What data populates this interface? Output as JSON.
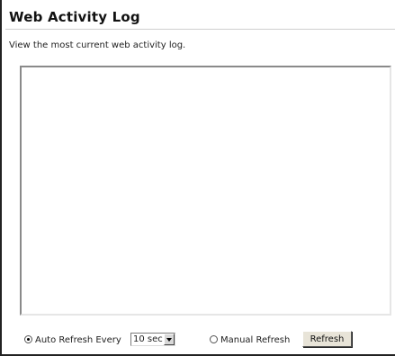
{
  "page": {
    "title": "Web Activity Log",
    "description": "View the most current web activity log."
  },
  "log": {
    "content": ""
  },
  "controls": {
    "auto_refresh": {
      "label": "Auto Refresh Every",
      "selected": true,
      "interval": "10 sec"
    },
    "manual_refresh": {
      "label": "Manual Refresh",
      "selected": false
    },
    "refresh_button_label": "Refresh"
  }
}
